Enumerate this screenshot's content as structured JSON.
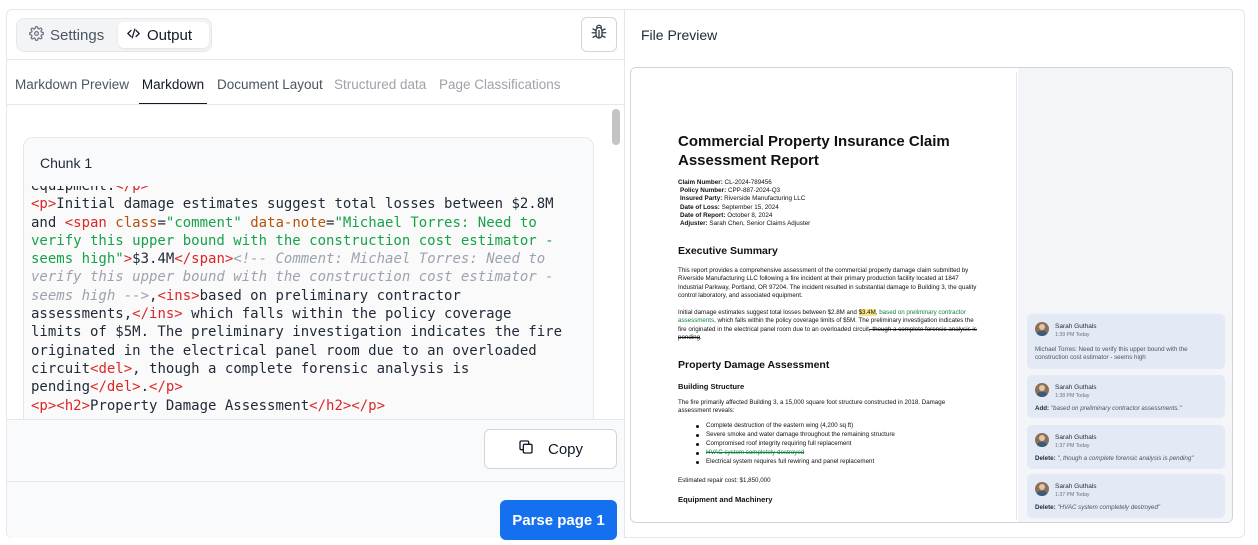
{
  "toolbar": {
    "settings_label": "Settings",
    "output_label": "Output"
  },
  "tabs": [
    {
      "label": "Markdown Preview",
      "state": "normal"
    },
    {
      "label": "Markdown",
      "state": "active"
    },
    {
      "label": "Document Layout",
      "state": "normal"
    },
    {
      "label": "Structured data",
      "state": "disabled"
    },
    {
      "label": "Page Classifications",
      "state": "disabled"
    }
  ],
  "chunk": {
    "title": "Chunk 1"
  },
  "actions": {
    "copy_label": "Copy",
    "parse_label": "Parse page 1"
  },
  "preview": {
    "title": "File Preview",
    "doc": {
      "title": "Commercial Property Insurance Claim Assessment Report",
      "meta": [
        {
          "label": "Claim Number:",
          "value": "CL-2024-789456"
        },
        {
          "label": "Policy Number:",
          "value": "CPP-887-2024-Q3"
        },
        {
          "label": "Insured Party:",
          "value": "Riverside Manufacturing LLC"
        },
        {
          "label": "Date of Loss:",
          "value": "September 15, 2024"
        },
        {
          "label": "Date of Report:",
          "value": "October 8, 2024"
        },
        {
          "label": "Adjuster:",
          "value": "Sarah Chen, Senior Claims Adjuster"
        }
      ],
      "exec_heading": "Executive Summary",
      "exec_p1": "This report provides a comprehensive assessment of the commercial property damage claim submitted by Riverside Manufacturing LLC following a fire incident at their primary production facility located at 1847 Industrial Parkway, Portland, OR 97204. The incident resulted in substantial damage to Building 3, the quality control laboratory, and associated equipment.",
      "exec_p2_a": "Initial damage estimates suggest total losses between $2.8M and ",
      "exec_p2_hl": "$3.4M",
      "exec_p2_b": ", ",
      "exec_p2_ins": "based on preliminary contractor assessments,",
      "exec_p2_c": " which falls within the policy coverage limits of $5M. The preliminary investigation indicates the fire originated in the electrical panel room due to an overloaded circuit",
      "exec_p2_del": ", though a complete forensic analysis is pending",
      "exec_p2_d": ".",
      "damage_heading": "Property Damage Assessment",
      "building_heading": "Building Structure",
      "building_p": "The fire primarily affected Building 3, a 15,000 square foot structure constructed in 2018. Damage assessment reveals:",
      "bullets": [
        "Complete destruction of the eastern wing (4,200 sq ft)",
        "Severe smoke and water damage throughout the remaining structure",
        "Compromised roof integrity requiring full replacement",
        "HVAC system completely destroyed",
        "Electrical system requires full rewiring and panel replacement"
      ],
      "repair_cost": "Estimated repair cost: $1,850,000",
      "equipment_heading": "Equipment and Machinery"
    },
    "comments": [
      {
        "name": "Sarah Guthals",
        "time": "1:39 PM Today",
        "prefix": "",
        "body": "Michael Torres: Need to verify this upper bound with the construction cost estimator - seems high"
      },
      {
        "name": "Sarah Guthals",
        "time": "1:38 PM Today",
        "prefix": "Add:",
        "body": "\"based on preliminary contractor assessments.\""
      },
      {
        "name": "Sarah Guthals",
        "time": "1:37 PM Today",
        "prefix": "Delete:",
        "body": "\", though a complete forensic analysis is pending\""
      },
      {
        "name": "Sarah Guthals",
        "time": "1:37 PM Today",
        "prefix": "Delete:",
        "body": "\"HVAC system completely destroyed\""
      }
    ]
  },
  "code": {
    "line0": [
      {
        "t": "equipment.",
        "c": "txt"
      },
      {
        "t": "</p>",
        "c": "tag"
      }
    ],
    "line1": [
      {
        "t": "<p>",
        "c": "tag"
      },
      {
        "t": "Initial damage estimates suggest total losses between $2.8M",
        "c": "txt"
      }
    ],
    "line2": [
      {
        "t": "and ",
        "c": "txt"
      },
      {
        "t": "<span ",
        "c": "tag"
      },
      {
        "t": "class",
        "c": "attr"
      },
      {
        "t": "=",
        "c": "txt"
      },
      {
        "t": "\"comment\"",
        "c": "str"
      },
      {
        "t": " ",
        "c": "txt"
      },
      {
        "t": "data-note",
        "c": "attr"
      },
      {
        "t": "=",
        "c": "txt"
      },
      {
        "t": "\"Michael Torres: Need to",
        "c": "str"
      }
    ],
    "line3": [
      {
        "t": "verify this upper bound with the construction cost estimator -",
        "c": "str"
      }
    ],
    "line4": [
      {
        "t": "seems high\"",
        "c": "str"
      },
      {
        "t": ">",
        "c": "tag"
      },
      {
        "t": "$3.4M",
        "c": "txt"
      },
      {
        "t": "</span>",
        "c": "tag"
      },
      {
        "t": "<!-- Comment: Michael Torres: Need to",
        "c": "cmt"
      }
    ],
    "line5": [
      {
        "t": "verify this upper bound with the construction cost estimator -",
        "c": "cmt"
      }
    ],
    "line6": [
      {
        "t": "seems high -->",
        "c": "cmt"
      },
      {
        "t": ",",
        "c": "txt"
      },
      {
        "t": "<ins>",
        "c": "tag"
      },
      {
        "t": "based on preliminary contractor",
        "c": "txt"
      }
    ],
    "line7": [
      {
        "t": "assessments,",
        "c": "txt"
      },
      {
        "t": "</ins>",
        "c": "tag"
      },
      {
        "t": " which falls within the policy coverage",
        "c": "txt"
      }
    ],
    "line8": [
      {
        "t": "limits of $5M. The preliminary investigation indicates the fire",
        "c": "txt"
      }
    ],
    "line9": [
      {
        "t": "originated in the electrical panel room due to an overloaded",
        "c": "txt"
      }
    ],
    "line10": [
      {
        "t": "circuit",
        "c": "txt"
      },
      {
        "t": "<del>",
        "c": "tag"
      },
      {
        "t": ", though a complete forensic analysis is",
        "c": "txt"
      }
    ],
    "line11": [
      {
        "t": "pending",
        "c": "txt"
      },
      {
        "t": "</del>",
        "c": "tag"
      },
      {
        "t": ".",
        "c": "txt"
      },
      {
        "t": "</p>",
        "c": "tag"
      }
    ],
    "line12": [
      {
        "t": "<p><h2>",
        "c": "tag"
      },
      {
        "t": "Property Damage Assessment",
        "c": "txt"
      },
      {
        "t": "</h2></p>",
        "c": "tag"
      }
    ]
  }
}
